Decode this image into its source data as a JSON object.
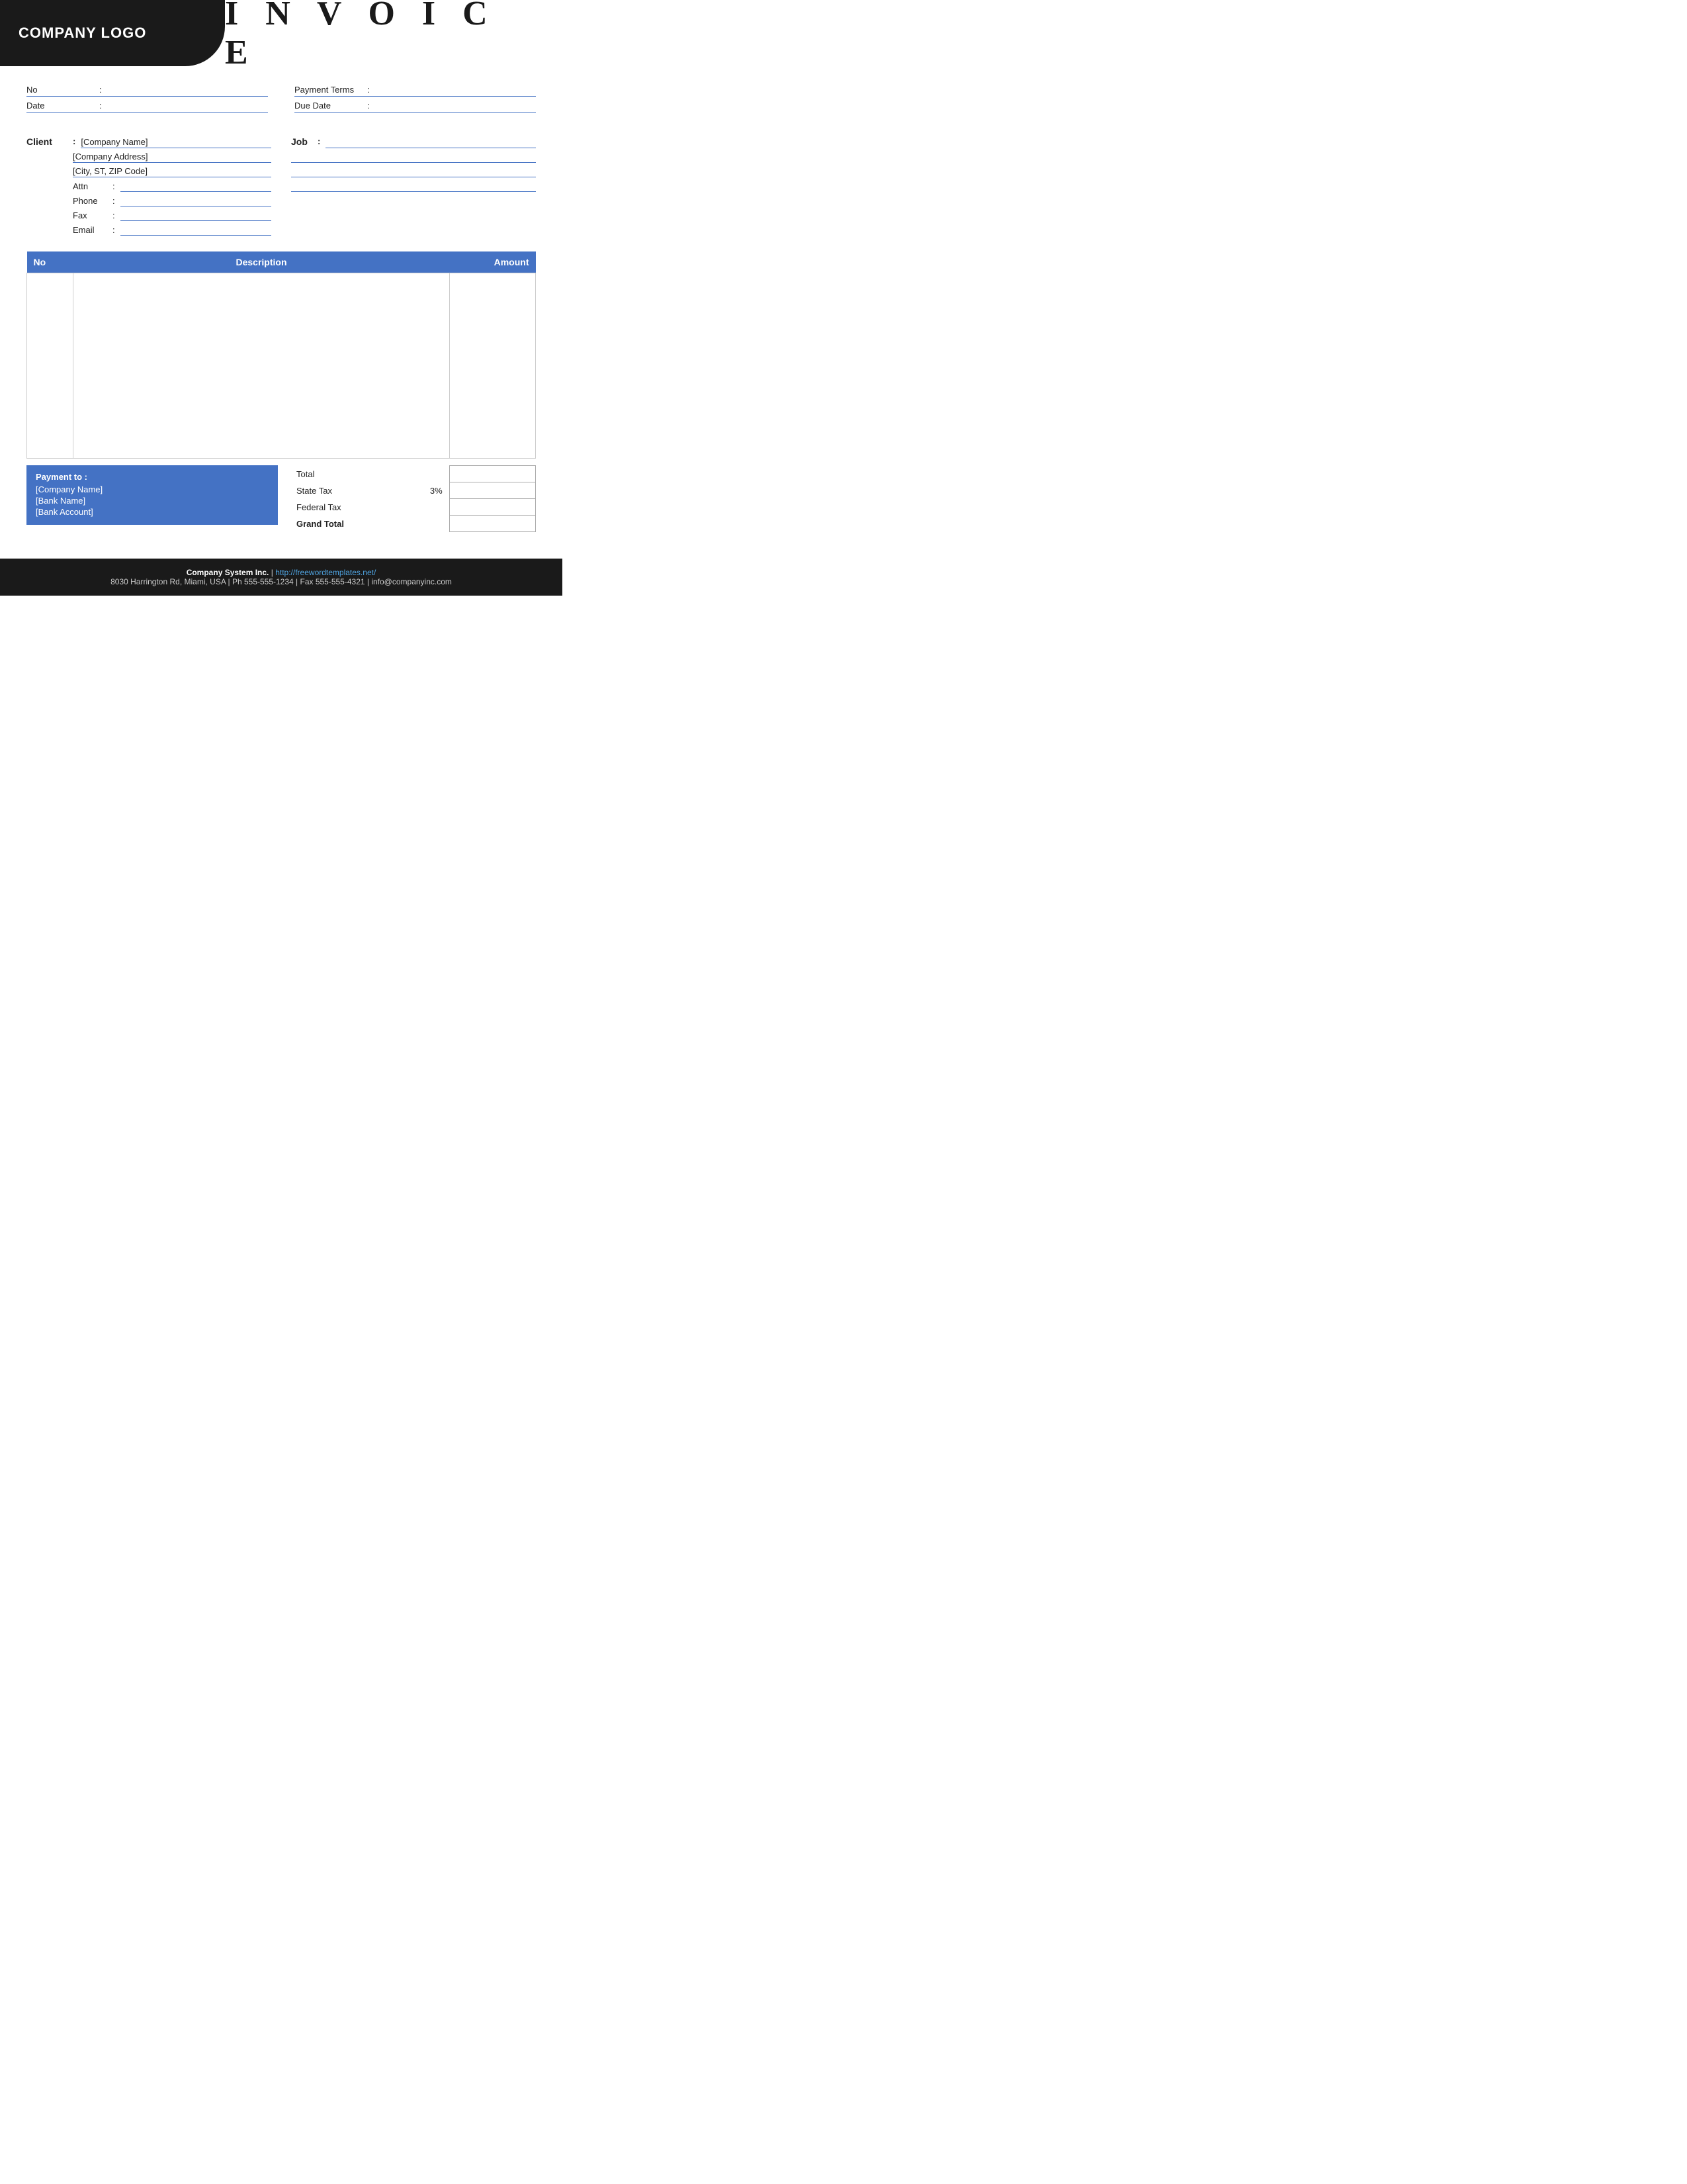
{
  "header": {
    "logo_text": "COMPANY LOGO",
    "invoice_title": "I N V O I C E"
  },
  "info": {
    "no_label": "No",
    "no_colon": ":",
    "no_value": "",
    "date_label": "Date",
    "date_colon": ":",
    "date_value": "",
    "payment_terms_label": "Payment  Terms",
    "payment_terms_colon": ":",
    "payment_terms_value": "",
    "due_date_label": "Due Date",
    "due_date_colon": ":",
    "due_date_value": ""
  },
  "client": {
    "label": "Client",
    "colon": ":",
    "company_name": "[Company Name]",
    "company_address": "[Company Address]",
    "city_state_zip": "[City, ST, ZIP Code]",
    "attn_label": "Attn",
    "attn_colon": ":",
    "attn_value": "",
    "phone_label": "Phone",
    "phone_colon": ":",
    "phone_value": "",
    "fax_label": "Fax",
    "fax_colon": ":",
    "fax_value": "",
    "email_label": "Email",
    "email_colon": ":",
    "email_value": ""
  },
  "job": {
    "label": "Job",
    "colon": ":",
    "line1": "",
    "line2": "",
    "line3": "",
    "line4": ""
  },
  "table": {
    "col_no": "No",
    "col_description": "Description",
    "col_amount": "Amount",
    "rows": []
  },
  "payment": {
    "title": "Payment to :",
    "company": "[Company Name]",
    "bank": "[Bank Name]",
    "account": "[Bank Account]"
  },
  "totals": {
    "total_label": "Total",
    "total_value": "",
    "state_tax_label": "State Tax",
    "state_tax_pct": "3%",
    "state_tax_value": "",
    "federal_tax_label": "Federal Tax",
    "federal_tax_value": "",
    "grand_total_label": "Grand Total",
    "grand_total_value": ""
  },
  "footer": {
    "company": "Company System Inc.",
    "separator": "|",
    "url": "http://freewordtemplates.net/",
    "address": "8030 Harrington Rd, Miami, USA | Ph 555-555-1234 | Fax 555-555-4321 | info@companyinc.com"
  }
}
